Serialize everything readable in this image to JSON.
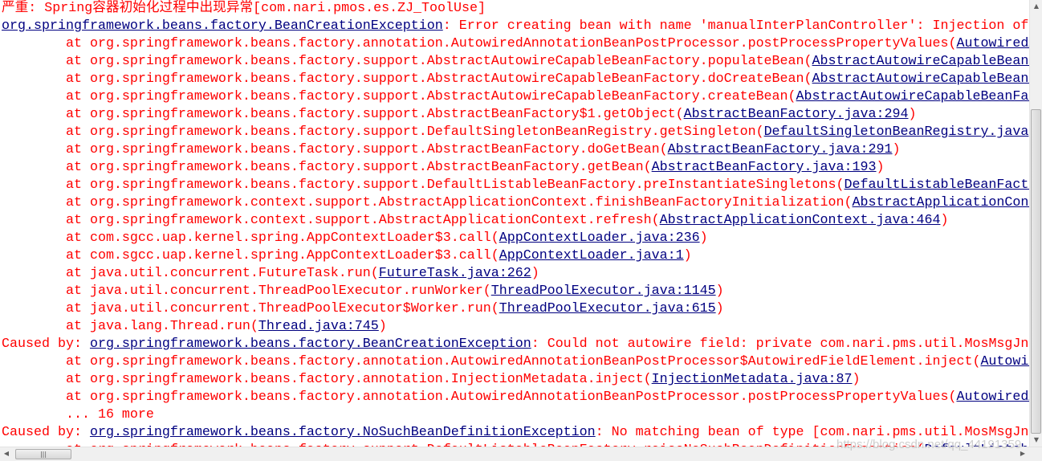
{
  "colors": {
    "error_text": "#ff0000",
    "link": "#000080",
    "background": "#ffffff"
  },
  "console": {
    "lines": [
      [
        {
          "t": "严重: Spring容器初始化过程中出现异常[com.nari.pmos.es.ZJ_ToolUse]"
        }
      ],
      [
        {
          "t": "org.springframework.beans.factory.BeanCreationException",
          "link": true
        },
        {
          "t": ": Error creating bean with name 'manualInterPlanController': Injection of"
        }
      ],
      [
        {
          "t": "        at org.springframework.beans.factory.annotation.AutowiredAnnotationBeanPostProcessor.postProcessPropertyValues("
        },
        {
          "t": "AutowiredAnnotationBeanPostProcessor.java",
          "link": true
        }
      ],
      [
        {
          "t": "        at org.springframework.beans.factory.support.AbstractAutowireCapableBeanFactory.populateBean("
        },
        {
          "t": "AbstractAutowireCapableBeanFactory.java",
          "link": true
        }
      ],
      [
        {
          "t": "        at org.springframework.beans.factory.support.AbstractAutowireCapableBeanFactory.doCreateBean("
        },
        {
          "t": "AbstractAutowireCapableBeanFactory.java",
          "link": true
        }
      ],
      [
        {
          "t": "        at org.springframework.beans.factory.support.AbstractAutowireCapableBeanFactory.createBean("
        },
        {
          "t": "AbstractAutowireCapableBeanFactory.java",
          "link": true
        }
      ],
      [
        {
          "t": "        at org.springframework.beans.factory.support.AbstractBeanFactory$1.getObject("
        },
        {
          "t": "AbstractBeanFactory.java:294",
          "link": true
        },
        {
          "t": ")"
        }
      ],
      [
        {
          "t": "        at org.springframework.beans.factory.support.DefaultSingletonBeanRegistry.getSingleton("
        },
        {
          "t": "DefaultSingletonBeanRegistry.java",
          "link": true
        }
      ],
      [
        {
          "t": "        at org.springframework.beans.factory.support.AbstractBeanFactory.doGetBean("
        },
        {
          "t": "AbstractBeanFactory.java:291",
          "link": true
        },
        {
          "t": ")"
        }
      ],
      [
        {
          "t": "        at org.springframework.beans.factory.support.AbstractBeanFactory.getBean("
        },
        {
          "t": "AbstractBeanFactory.java:193",
          "link": true
        },
        {
          "t": ")"
        }
      ],
      [
        {
          "t": "        at org.springframework.beans.factory.support.DefaultListableBeanFactory.preInstantiateSingletons("
        },
        {
          "t": "DefaultListableBeanFactory.java",
          "link": true
        }
      ],
      [
        {
          "t": "        at org.springframework.context.support.AbstractApplicationContext.finishBeanFactoryInitialization("
        },
        {
          "t": "AbstractApplicationContext.java",
          "link": true
        }
      ],
      [
        {
          "t": "        at org.springframework.context.support.AbstractApplicationContext.refresh("
        },
        {
          "t": "AbstractApplicationContext.java:464",
          "link": true
        },
        {
          "t": ")"
        }
      ],
      [
        {
          "t": "        at com.sgcc.uap.kernel.spring.AppContextLoader$3.call("
        },
        {
          "t": "AppContextLoader.java:236",
          "link": true
        },
        {
          "t": ")"
        }
      ],
      [
        {
          "t": "        at com.sgcc.uap.kernel.spring.AppContextLoader$3.call("
        },
        {
          "t": "AppContextLoader.java:1",
          "link": true
        },
        {
          "t": ")"
        }
      ],
      [
        {
          "t": "        at java.util.concurrent.FutureTask.run("
        },
        {
          "t": "FutureTask.java:262",
          "link": true
        },
        {
          "t": ")"
        }
      ],
      [
        {
          "t": "        at java.util.concurrent.ThreadPoolExecutor.runWorker("
        },
        {
          "t": "ThreadPoolExecutor.java:1145",
          "link": true
        },
        {
          "t": ")"
        }
      ],
      [
        {
          "t": "        at java.util.concurrent.ThreadPoolExecutor$Worker.run("
        },
        {
          "t": "ThreadPoolExecutor.java:615",
          "link": true
        },
        {
          "t": ")"
        }
      ],
      [
        {
          "t": "        at java.lang.Thread.run("
        },
        {
          "t": "Thread.java:745",
          "link": true
        },
        {
          "t": ")"
        }
      ],
      [
        {
          "t": "Caused by: "
        },
        {
          "t": "org.springframework.beans.factory.BeanCreationException",
          "link": true
        },
        {
          "t": ": Could not autowire field: private com.nari.pms.util.MosMsgJn"
        }
      ],
      [
        {
          "t": "        at org.springframework.beans.factory.annotation.AutowiredAnnotationBeanPostProcessor$AutowiredFieldElement.inject("
        },
        {
          "t": "AutowiredAnnotationBeanPostProcessor.java",
          "link": true
        }
      ],
      [
        {
          "t": "        at org.springframework.beans.factory.annotation.InjectionMetadata.inject("
        },
        {
          "t": "InjectionMetadata.java:87",
          "link": true
        },
        {
          "t": ")"
        }
      ],
      [
        {
          "t": "        at org.springframework.beans.factory.annotation.AutowiredAnnotationBeanPostProcessor.postProcessPropertyValues("
        },
        {
          "t": "AutowiredAnnotationBeanPostProcessor.java",
          "link": true
        }
      ],
      [
        {
          "t": "        ... 16 more"
        }
      ],
      [
        {
          "t": "Caused by: "
        },
        {
          "t": "org.springframework.beans.factory.NoSuchBeanDefinitionException",
          "link": true
        },
        {
          "t": ": No matching bean of type [com.nari.pms.util.MosMsgJn"
        }
      ],
      [
        {
          "t": "        at org.springframework.beans.factory.support.DefaultListableBeanFactory.raiseNoSuchBeanDefinitionException("
        },
        {
          "t": "DefaultListableBeanFactory.java",
          "link": true
        }
      ]
    ]
  },
  "watermark": "https://blog.csdn.net/qq_44191359",
  "icons": {
    "scroll_up": "triangle-up-icon",
    "scroll_down": "triangle-down-icon",
    "scroll_left": "triangle-left-icon",
    "scroll_right": "triangle-right-icon",
    "grip": "grip-icon"
  }
}
